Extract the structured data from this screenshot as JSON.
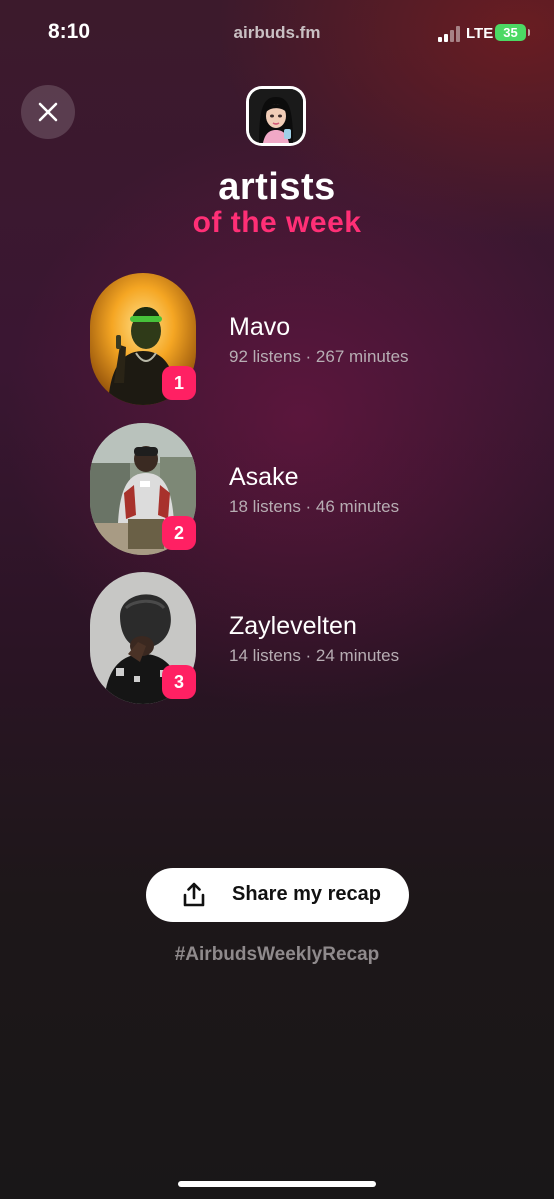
{
  "status_bar": {
    "time": "8:10",
    "url": "airbuds.fm",
    "network": "LTE",
    "battery": "35"
  },
  "header": {
    "close_icon": "close-icon",
    "avatar_icon": "profile-avatar-icon",
    "title": "artists",
    "subtitle": "of the week"
  },
  "artists": [
    {
      "rank": "1",
      "name": "Mavo",
      "stats": "92 listens · 267 minutes"
    },
    {
      "rank": "2",
      "name": "Asake",
      "stats": "18 listens · 46 minutes"
    },
    {
      "rank": "3",
      "name": "Zaylevelten",
      "stats": "14 listens · 24 minutes"
    }
  ],
  "share": {
    "label": "Share my recap",
    "icon": "share-icon"
  },
  "hashtag": "#AirbudsWeeklyRecap",
  "colors": {
    "accent": "#ff2f76",
    "badge": "#ff2063",
    "battery": "#4cd964"
  }
}
